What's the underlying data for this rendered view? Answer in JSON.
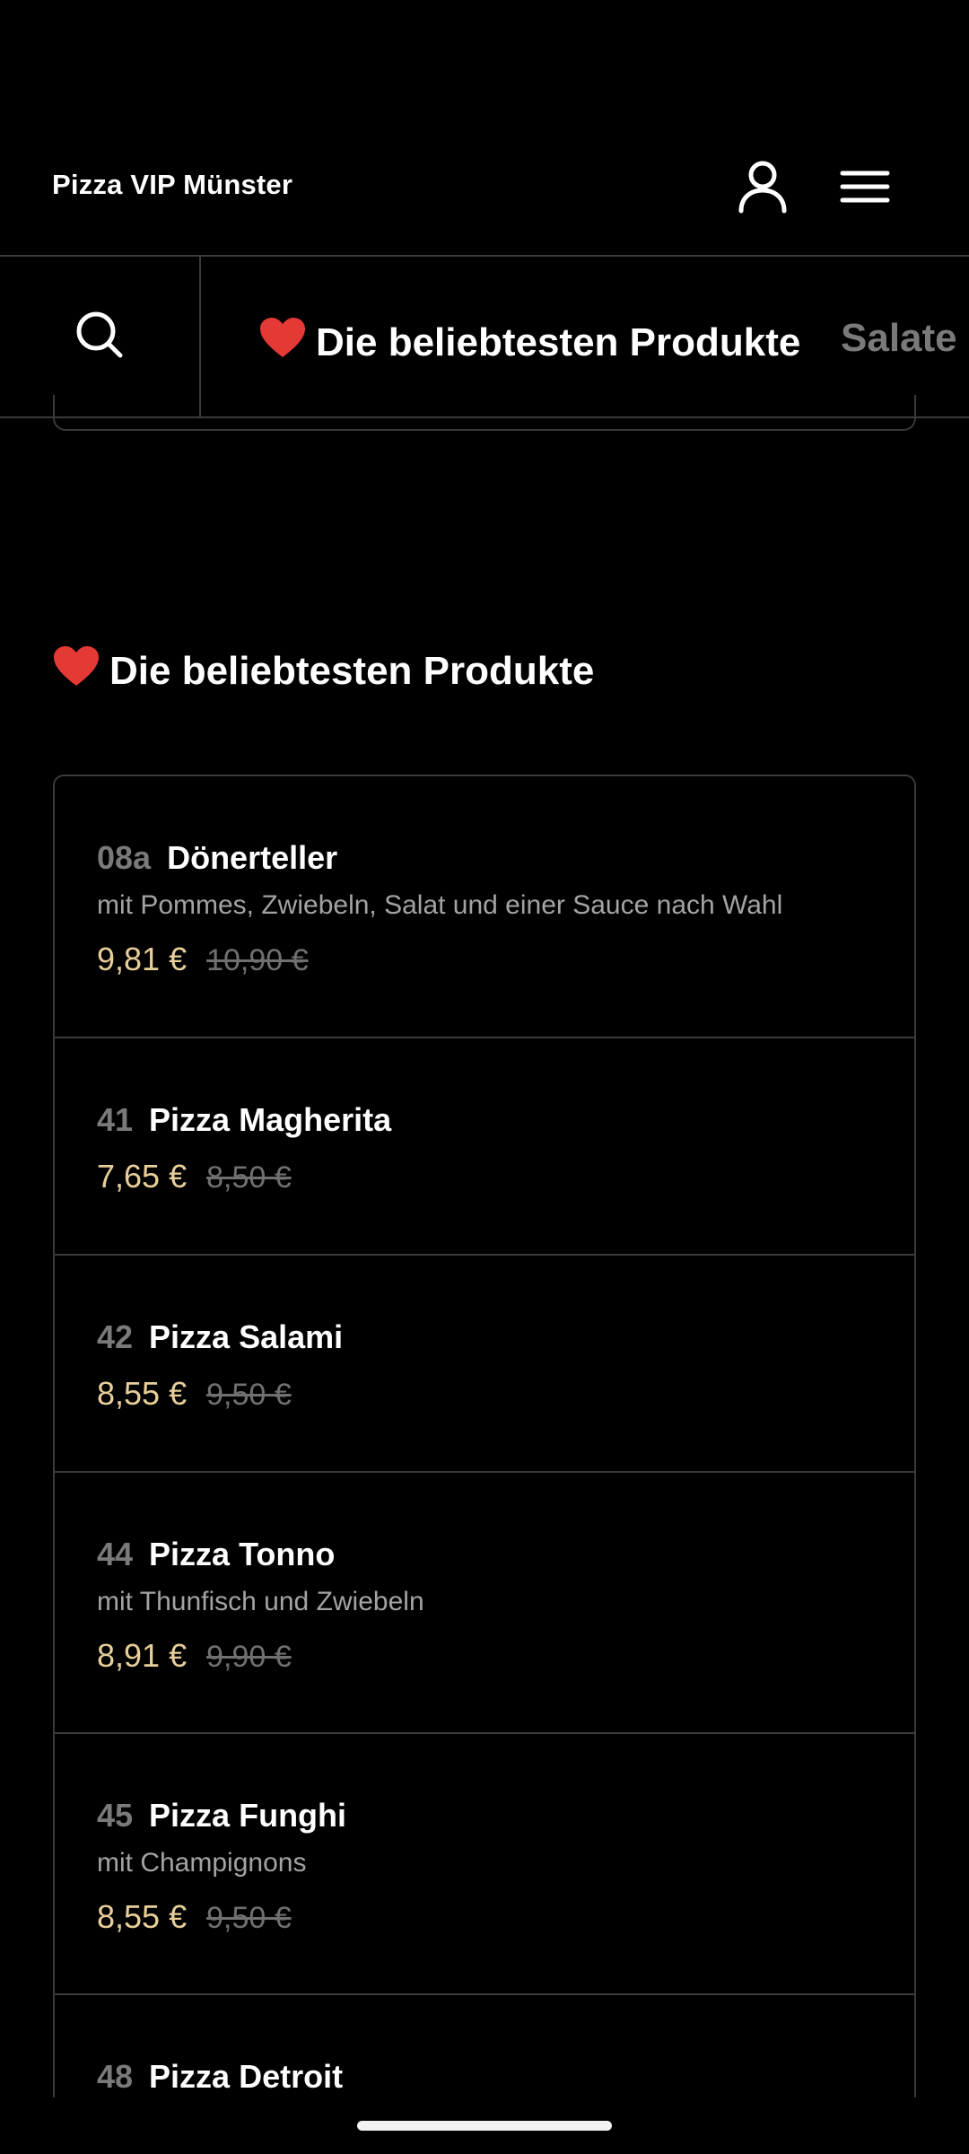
{
  "header": {
    "store_name": "Pizza VIP Münster",
    "account_icon": "user-icon",
    "menu_icon": "hamburger-menu-icon"
  },
  "category_bar": {
    "search_icon": "search-icon",
    "tabs": [
      {
        "label": "Die beliebtesten Produkte",
        "icon": "heart-icon",
        "active": true
      },
      {
        "label": "Salate",
        "active": false
      }
    ]
  },
  "section": {
    "title": "Die beliebtesten Produkte",
    "icon": "heart-icon"
  },
  "products": [
    {
      "number": "08a",
      "name": "Dönerteller",
      "description": "mit Pommes, Zwiebeln, Salat und einer Sauce nach Wahl",
      "price": "9,81 €",
      "old_price": "10,90 €"
    },
    {
      "number": "41",
      "name": "Pizza Magherita",
      "description": "",
      "price": "7,65 €",
      "old_price": "8,50 €"
    },
    {
      "number": "42",
      "name": "Pizza Salami",
      "description": "",
      "price": "8,55 €",
      "old_price": "9,50 €"
    },
    {
      "number": "44",
      "name": "Pizza Tonno",
      "description": "mit Thunfisch und Zwiebeln",
      "price": "8,91 €",
      "old_price": "9,90 €"
    },
    {
      "number": "45",
      "name": "Pizza Funghi",
      "description": "mit Champignons",
      "price": "8,55 €",
      "old_price": "9,50 €"
    },
    {
      "number": "48",
      "name": "Pizza Detroit",
      "description": "",
      "price": "",
      "old_price": ""
    }
  ],
  "colors": {
    "background": "#000000",
    "border": "#3a3a3a",
    "price": "#e8cf9a",
    "old_price": "#707070",
    "heart": "#e53935"
  }
}
